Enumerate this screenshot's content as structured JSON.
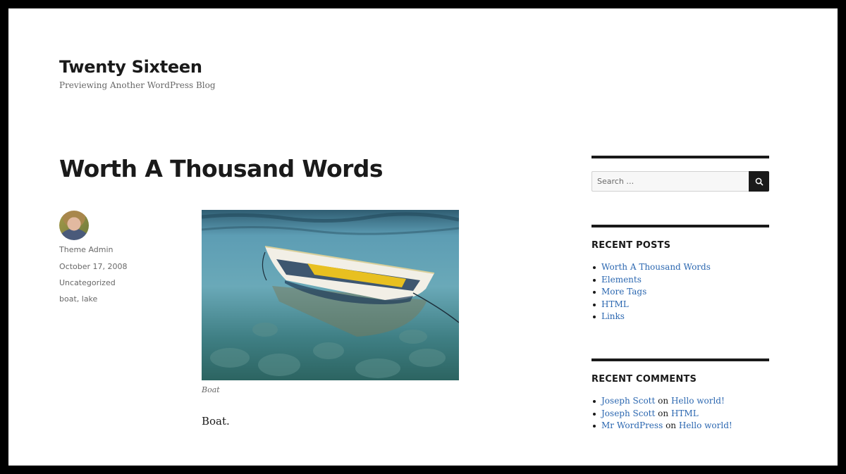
{
  "site": {
    "title": "Twenty Sixteen",
    "description": "Previewing Another WordPress Blog"
  },
  "post": {
    "title": "Worth A Thousand Words",
    "author": "Theme Admin",
    "date": "October 17, 2008",
    "category": "Uncategorized",
    "tags": "boat, lake",
    "image_alt": "Boat",
    "caption": "Boat",
    "content": "Boat."
  },
  "sidebar": {
    "search": {
      "placeholder": "Search …",
      "button_icon": "search-icon"
    },
    "recent_posts": {
      "title": "RECENT POSTS",
      "items": [
        "Worth A Thousand Words",
        "Elements",
        "More Tags",
        "HTML",
        "Links"
      ]
    },
    "recent_comments": {
      "title": "RECENT COMMENTS",
      "items": [
        {
          "author": "Joseph Scott",
          "sep": "on",
          "post": "Hello world!"
        },
        {
          "author": "Joseph Scott",
          "sep": "on",
          "post": "HTML"
        },
        {
          "author": "Mr WordPress",
          "sep": "on",
          "post": "Hello world!"
        }
      ]
    }
  },
  "colors": {
    "link": "#2b67b0",
    "text": "#1a1a1a",
    "meta": "#686868",
    "frame": "#000000"
  }
}
